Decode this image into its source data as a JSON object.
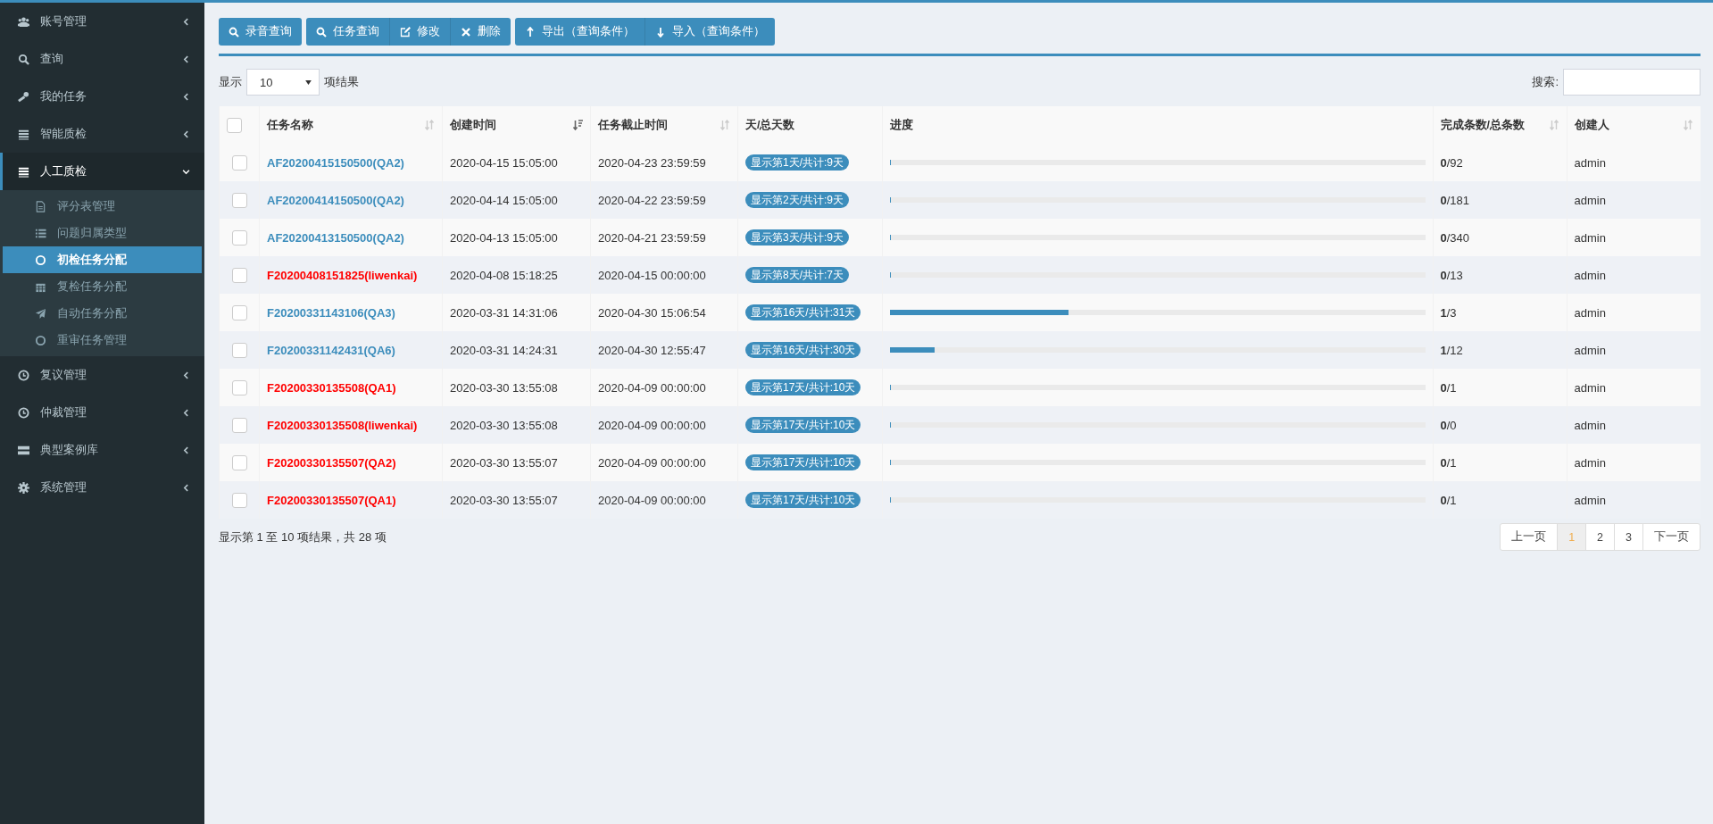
{
  "sidebar": {
    "items": [
      {
        "label": "账号管理",
        "expanded": false
      },
      {
        "label": "查询",
        "expanded": false
      },
      {
        "label": "我的任务",
        "expanded": false
      },
      {
        "label": "智能质检",
        "expanded": false
      },
      {
        "label": "人工质检",
        "expanded": true,
        "children": [
          {
            "label": "评分表管理",
            "selected": false
          },
          {
            "label": "问题归属类型",
            "selected": false
          },
          {
            "label": "初检任务分配",
            "selected": true
          },
          {
            "label": "复检任务分配",
            "selected": false
          },
          {
            "label": "自动任务分配",
            "selected": false
          },
          {
            "label": "重审任务管理",
            "selected": false
          }
        ]
      },
      {
        "label": "复议管理",
        "expanded": false
      },
      {
        "label": "仲裁管理",
        "expanded": false
      },
      {
        "label": "典型案例库",
        "expanded": false
      },
      {
        "label": "系统管理",
        "expanded": false
      }
    ]
  },
  "toolbar": [
    [
      "录音查询"
    ],
    [
      "任务查询",
      "修改",
      "删除"
    ],
    [
      "导出（查询条件）",
      "导入（查询条件）"
    ]
  ],
  "length_menu": {
    "before": "显示",
    "value": "10",
    "after": "项结果"
  },
  "search": {
    "label": "搜索:"
  },
  "table": {
    "select_all_checked": false,
    "columns": [
      {
        "label": "任务名称",
        "sortable": true,
        "sorted": false
      },
      {
        "label": "创建时间",
        "sortable": true,
        "sorted": true
      },
      {
        "label": "任务截止时间",
        "sortable": true,
        "sorted": false
      },
      {
        "label": "天/总天数",
        "sortable": false
      },
      {
        "label": "进度",
        "sortable": false
      },
      {
        "label": "完成条数/总条数",
        "sortable": true,
        "sorted": false
      },
      {
        "label": "创建人",
        "sortable": true,
        "sorted": false
      }
    ],
    "rows": [
      {
        "checked": false,
        "name": "AF20200415150500(QA2)",
        "color": "#3c8dbc",
        "created": "2020-04-15 15:05:00",
        "deadline": "2020-04-23 23:59:59",
        "days": "显示第1天/共计:9天",
        "level": 0,
        "count": "**0**/92",
        "creator": "admin"
      },
      {
        "checked": false,
        "name": "AF20200414150500(QA2)",
        "color": "#3c8dbc",
        "created": "2020-04-14 15:05:00",
        "deadline": "2020-04-22 23:59:59",
        "days": "显示第2天/共计:9天",
        "level": 0,
        "count": "**0**/181",
        "creator": "admin"
      },
      {
        "checked": false,
        "name": "AF20200413150500(QA2)",
        "color": "#3c8dbc",
        "created": "2020-04-13 15:05:00",
        "deadline": "2020-04-21 23:59:59",
        "days": "显示第3天/共计:9天",
        "level": 0,
        "count": "**0**/340",
        "creator": "admin"
      },
      {
        "checked": false,
        "name": "F20200408151825(liwenkai)",
        "color": "#ff0000",
        "created": "2020-04-08 15:18:25",
        "deadline": "2020-04-15 00:00:00",
        "days": "显示第8天/共计:7天",
        "level": 0,
        "count": "**0**/13",
        "creator": "admin"
      },
      {
        "checked": false,
        "name": "F20200331143106(QA3)",
        "color": "#3c8dbc",
        "created": "2020-03-31 14:31:06",
        "deadline": "2020-04-30 15:06:54",
        "days": "显示第16天/共计:31天",
        "level": 0.333,
        "count": "**1**/3",
        "creator": "admin"
      },
      {
        "checked": false,
        "name": "F20200331142431(QA6)",
        "color": "#3c8dbc",
        "created": "2020-03-31 14:24:31",
        "deadline": "2020-04-30 12:55:47",
        "days": "显示第16天/共计:30天",
        "level": 0.083,
        "count": "**1**/12",
        "creator": "admin"
      },
      {
        "checked": false,
        "name": "F20200330135508(QA1)",
        "color": "#ff0000",
        "created": "2020-03-30 13:55:08",
        "deadline": "2020-04-09 00:00:00",
        "days": "显示第17天/共计:10天",
        "level": 0,
        "count": "**0**/1",
        "creator": "admin"
      },
      {
        "checked": false,
        "name": "F20200330135508(liwenkai)",
        "color": "#ff0000",
        "created": "2020-03-30 13:55:08",
        "deadline": "2020-04-09 00:00:00",
        "days": "显示第17天/共计:10天",
        "level": 0,
        "count": "**0**/0",
        "creator": "admin"
      },
      {
        "checked": false,
        "name": "F20200330135507(QA2)",
        "color": "#ff0000",
        "created": "2020-03-30 13:55:07",
        "deadline": "2020-04-09 00:00:00",
        "days": "显示第17天/共计:10天",
        "level": 0,
        "count": "**0**/1",
        "creator": "admin"
      },
      {
        "checked": false,
        "name": "F20200330135507(QA1)",
        "color": "#ff0000",
        "created": "2020-03-30 13:55:07",
        "deadline": "2020-04-09 00:00:00",
        "days": "显示第17天/共计:10天",
        "level": 0,
        "count": "**0**/1",
        "creator": "admin"
      }
    ]
  },
  "info": "显示第 1 至 10 项结果，共 28 项",
  "pagination": [
    {
      "label": "上一页",
      "selected": false
    },
    {
      "label": "1",
      "selected": true
    },
    {
      "label": "2",
      "selected": false
    },
    {
      "label": "3",
      "selected": false
    },
    {
      "label": "下一页",
      "selected": false
    }
  ]
}
